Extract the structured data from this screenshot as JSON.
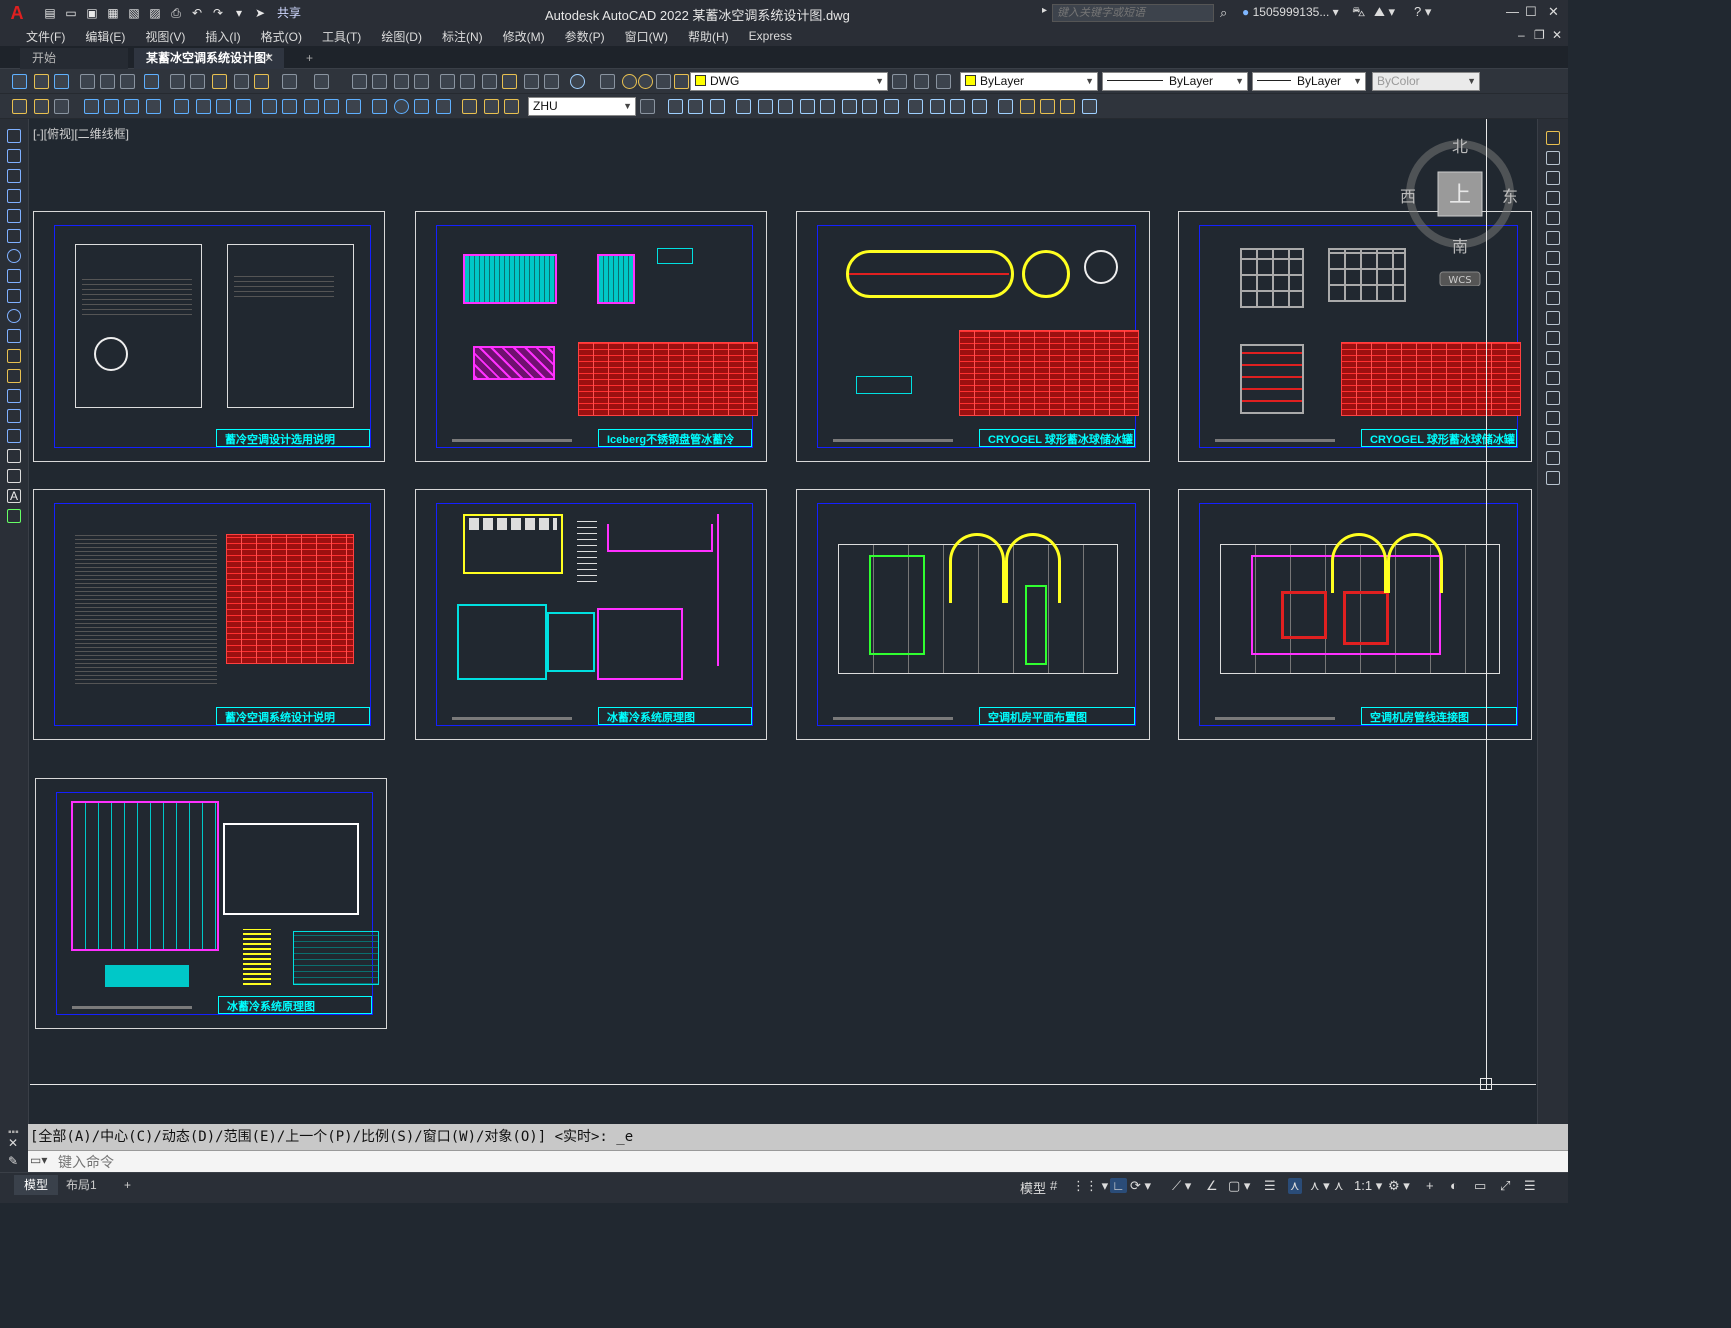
{
  "colors": {
    "canvas_bg": "#212830",
    "frame": "#1420ff",
    "title": "#00ffff",
    "table_red": "#9c1010",
    "border": "#d8d8d8"
  },
  "titlebar": {
    "title": "Autodesk AutoCAD 2022    某蓄冰空调系统设计图.dwg",
    "share": "共享",
    "search_placeholder": "键入关键字或短语",
    "user": "1505999135...",
    "help": "?"
  },
  "menu": [
    "文件(F)",
    "编辑(E)",
    "视图(V)",
    "插入(I)",
    "格式(O)",
    "工具(T)",
    "绘图(D)",
    "标注(N)",
    "修改(M)",
    "参数(P)",
    "窗口(W)",
    "帮助(H)",
    "Express"
  ],
  "tabs": {
    "start": "开始",
    "doc": "某蓄冰空调系统设计图*",
    "add": "+"
  },
  "toolbar": {
    "layer": "DWG",
    "color": "ByLayer",
    "linetype": "ByLayer",
    "lineweight": "ByLayer",
    "plotstyle": "ByColor",
    "textstyle": "ZHU"
  },
  "viewport": {
    "label": "[-][俯视][二维线框]"
  },
  "compass": {
    "north": "北",
    "south": "南",
    "east": "东",
    "west": "西",
    "top": "上",
    "wcs": "WCS"
  },
  "sheets": [
    {
      "title": "蓄冷空调设计选用说明"
    },
    {
      "title": "Iceberg不锈钢盘管冰蓄冷"
    },
    {
      "title": "CRYOGEL 球形蓄冰球储冰罐"
    },
    {
      "title": "CRYOGEL 球形蓄冰球储冰罐"
    },
    {
      "title": "蓄冷空调系统设计说明"
    },
    {
      "title": "冰蓄冷系统原理图"
    },
    {
      "title": "空调机房平面布置图"
    },
    {
      "title": "空调机房管线连接图"
    },
    {
      "title": "冰蓄冷系统原理图"
    }
  ],
  "command": {
    "history": "[全部(A)/中心(C)/动态(D)/范围(E)/上一个(P)/比例(S)/窗口(W)/对象(O)] <实时>: _e",
    "placeholder": "键入命令"
  },
  "status": {
    "model_tab": "模型",
    "layout1": "布局1",
    "add": "+",
    "space": "模型",
    "scale": "1:1"
  }
}
